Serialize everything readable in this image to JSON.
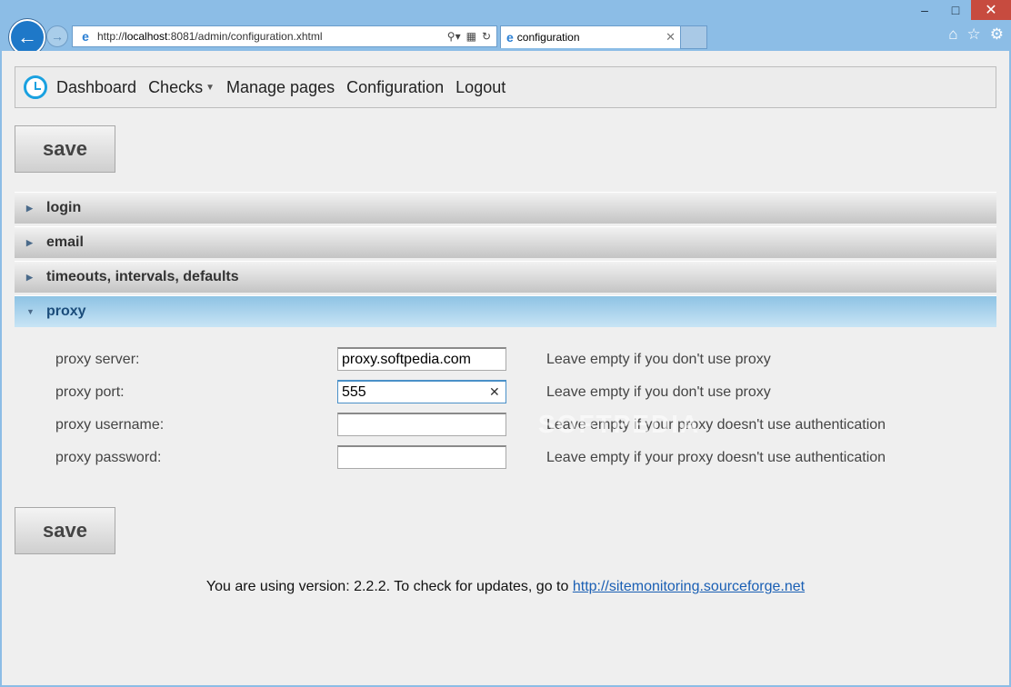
{
  "browser": {
    "url_prefix": "http://",
    "url_host": "localhost",
    "url_rest": ":8081/admin/configuration.xhtml",
    "tab_title": "configuration",
    "search_icon": "search-icon",
    "compat_icon": "compat-icon",
    "refresh_icon": "refresh-icon"
  },
  "nav": {
    "items": [
      "Dashboard",
      "Checks",
      "Manage pages",
      "Configuration",
      "Logout"
    ]
  },
  "actions": {
    "save_label": "save"
  },
  "sections": [
    "login",
    "email",
    "timeouts, intervals, defaults",
    "proxy"
  ],
  "proxy": {
    "fields": [
      {
        "label": "proxy server:",
        "value": "proxy.softpedia.com",
        "hint": "Leave empty if you don't use proxy"
      },
      {
        "label": "proxy port:",
        "value": "555",
        "hint": "Leave empty if you don't use proxy"
      },
      {
        "label": "proxy username:",
        "value": "",
        "hint": "Leave empty if your proxy doesn't use authentication"
      },
      {
        "label": "proxy password:",
        "value": "",
        "hint": "Leave empty if your proxy doesn't use authentication"
      }
    ]
  },
  "footer": {
    "text": "You are using version: 2.2.2. To check for updates, go to ",
    "link": "http://sitemonitoring.sourceforge.net"
  },
  "watermark": "SOFTPEDIA"
}
